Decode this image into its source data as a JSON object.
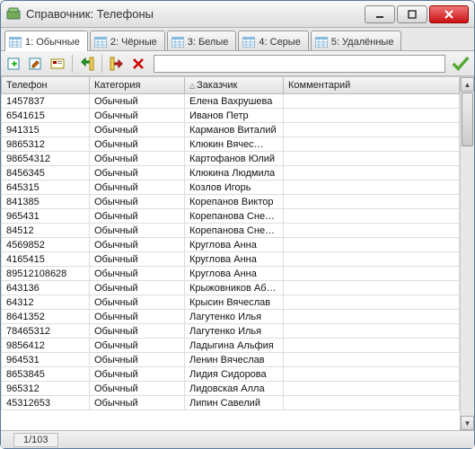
{
  "window": {
    "title": "Справочник: Телефоны"
  },
  "tabs": [
    {
      "label": "1: Обычные",
      "active": true
    },
    {
      "label": "2: Чёрные",
      "active": false
    },
    {
      "label": "3: Белые",
      "active": false
    },
    {
      "label": "4: Серые",
      "active": false
    },
    {
      "label": "5: Удалённые",
      "active": false
    }
  ],
  "search": {
    "value": "",
    "placeholder": ""
  },
  "columns": {
    "phone": "Телефон",
    "category": "Категория",
    "customer": "Заказчик",
    "comment": "Комментарий"
  },
  "sort_column": "customer",
  "rows": [
    {
      "phone": "1457837",
      "category": "Обычный",
      "customer": "Елена Вахрушева",
      "comment": ""
    },
    {
      "phone": "6541615",
      "category": "Обычный",
      "customer": "Иванов Петр",
      "comment": ""
    },
    {
      "phone": "941315",
      "category": "Обычный",
      "customer": "Карманов Виталий",
      "comment": ""
    },
    {
      "phone": "9865312",
      "category": "Обычный",
      "customer": "Клюкин Вячес…",
      "comment": ""
    },
    {
      "phone": "98654312",
      "category": "Обычный",
      "customer": "Картофанов Юлий",
      "comment": ""
    },
    {
      "phone": "8456345",
      "category": "Обычный",
      "customer": "Клюкина Людмила",
      "comment": ""
    },
    {
      "phone": "645315",
      "category": "Обычный",
      "customer": "Козлов Игорь",
      "comment": ""
    },
    {
      "phone": "841385",
      "category": "Обычный",
      "customer": "Корепанов Виктор",
      "comment": ""
    },
    {
      "phone": "965431",
      "category": "Обычный",
      "customer": "Корепанова Сне…",
      "comment": ""
    },
    {
      "phone": "84512",
      "category": "Обычный",
      "customer": "Корепанова Сне…",
      "comment": ""
    },
    {
      "phone": "4569852",
      "category": "Обычный",
      "customer": "Круглова Анна",
      "comment": ""
    },
    {
      "phone": "4165415",
      "category": "Обычный",
      "customer": "Круглова Анна",
      "comment": ""
    },
    {
      "phone": "89512108628",
      "category": "Обычный",
      "customer": "Круглова Анна",
      "comment": ""
    },
    {
      "phone": "643136",
      "category": "Обычный",
      "customer": "Крыжовников Аб…",
      "comment": ""
    },
    {
      "phone": "64312",
      "category": "Обычный",
      "customer": "Крысин Вячеслав",
      "comment": ""
    },
    {
      "phone": "8641352",
      "category": "Обычный",
      "customer": "Лагутенко Илья",
      "comment": ""
    },
    {
      "phone": "78465312",
      "category": "Обычный",
      "customer": "Лагутенко Илья",
      "comment": ""
    },
    {
      "phone": "9856412",
      "category": "Обычный",
      "customer": "Ладыгина Альфия",
      "comment": ""
    },
    {
      "phone": "964531",
      "category": "Обычный",
      "customer": "Ленин Вячеслав",
      "comment": ""
    },
    {
      "phone": "8653845",
      "category": "Обычный",
      "customer": "Лидия Сидорова",
      "comment": ""
    },
    {
      "phone": "965312",
      "category": "Обычный",
      "customer": "Лидовская Алла",
      "comment": ""
    },
    {
      "phone": "45312653",
      "category": "Обычный",
      "customer": "Липин Савелий",
      "comment": ""
    }
  ],
  "status": {
    "position": "1/103"
  }
}
